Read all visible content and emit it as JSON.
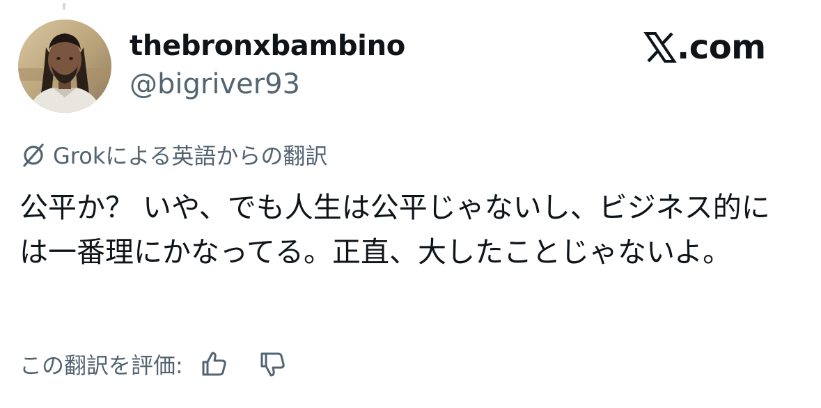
{
  "user": {
    "display_name": "thebronxbambino",
    "handle": "@bigriver93"
  },
  "brand": {
    "icon": "x-logo-icon",
    "text": ".com"
  },
  "translation": {
    "icon": "grok-icon",
    "label": "Grokによる英語からの翻訳"
  },
  "tweet": {
    "text": "公平か？ いや、でも人生は公平じゃないし、ビジネス的には一番理にかなってる。正直、大したことじゃないよ。"
  },
  "rating": {
    "label": "この翻訳を評価:",
    "thumbs_up_icon": "thumbs-up-icon",
    "thumbs_down_icon": "thumbs-down-icon"
  },
  "colors": {
    "text_primary": "#0f1419",
    "text_secondary": "#536471",
    "background": "#ffffff"
  }
}
